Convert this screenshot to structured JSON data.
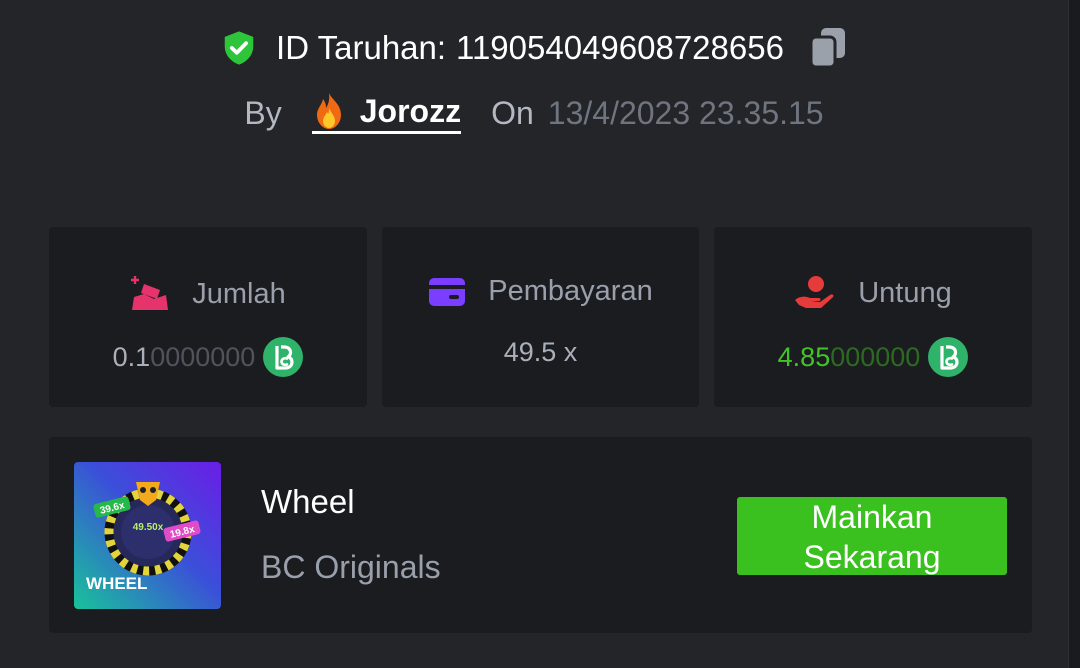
{
  "header": {
    "bet_id_label": "ID Taruhan:",
    "bet_id_value": "119054049608728656",
    "by_label": "By",
    "username": "Jorozz",
    "on_label": "On",
    "timestamp": "13/4/2023 23.35.15"
  },
  "stats": [
    {
      "label": "Jumlah",
      "value_main": "0.1",
      "value_dim": "0000000",
      "icon": "bet-amount-icon"
    },
    {
      "label": "Pembayaran",
      "value": "49.5 x",
      "icon": "wallet-icon"
    },
    {
      "label": "Untung",
      "value_main": "4.85",
      "value_dim": "000000",
      "icon": "profit-hand-icon"
    }
  ],
  "game": {
    "title": "Wheel",
    "provider": "BC Originals",
    "play_label_line1": "Mainkan",
    "play_label_line2": "Sekarang",
    "thumb_title": "WHEEL",
    "thumb_multipliers": [
      "39.6x",
      "49.50x",
      "19.8x"
    ]
  },
  "colors": {
    "background": "#232528",
    "card": "#1b1c1f",
    "profit_green": "#42c429",
    "button_green": "#3bc11f",
    "pink_icon": "#e5336b",
    "purple_icon": "#7b3dff",
    "red_icon": "#e63b3b",
    "coin": "#2fb36b"
  }
}
